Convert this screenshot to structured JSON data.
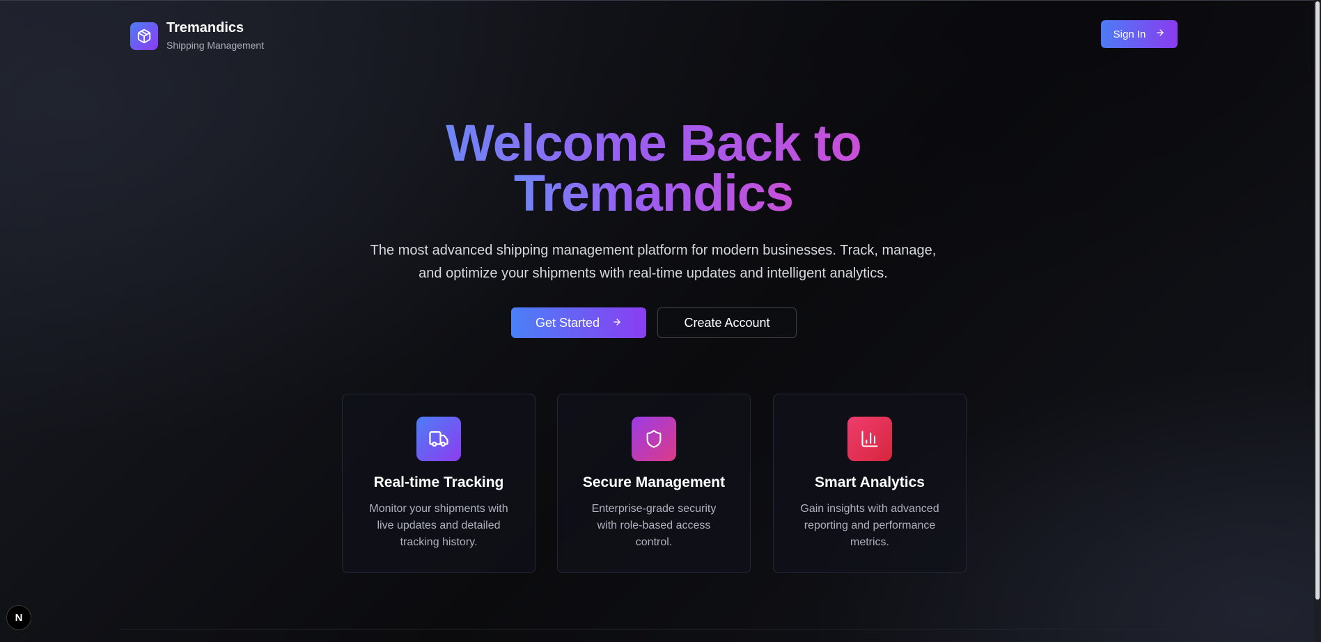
{
  "header": {
    "brand_name": "Tremandics",
    "brand_subtitle": "Shipping Management",
    "brand_icon": "package-icon",
    "signin_label": "Sign In"
  },
  "hero": {
    "title_line1": "Welcome Back to",
    "title_line2": "Tremandics",
    "description_line1": "The most advanced shipping management platform for modern businesses. Track, manage,",
    "description_line2": "and optimize your shipments with real-time updates and intelligent analytics.",
    "primary_button": "Get Started",
    "secondary_button": "Create Account"
  },
  "features": [
    {
      "title": "Real-time Tracking",
      "description": "Monitor your shipments with live updates and detailed tracking history.",
      "icon": "truck-icon",
      "gradient": [
        "#4d7ef6",
        "#8d3cef"
      ]
    },
    {
      "title": "Secure Management",
      "description": "Enterprise-grade security with role-based access control.",
      "icon": "shield-icon",
      "gradient": [
        "#9c3ce6",
        "#dc3a86"
      ]
    },
    {
      "title": "Smart Analytics",
      "description": "Gain insights with advanced reporting and performance metrics.",
      "icon": "bar-chart-icon",
      "gradient": [
        "#ee3d6e",
        "#d7263d"
      ]
    }
  ],
  "dev_badge": "N",
  "colors": {
    "accent_start": "#4c7cf5",
    "accent_end": "#8a3cf0",
    "background": "#0b0c10"
  }
}
